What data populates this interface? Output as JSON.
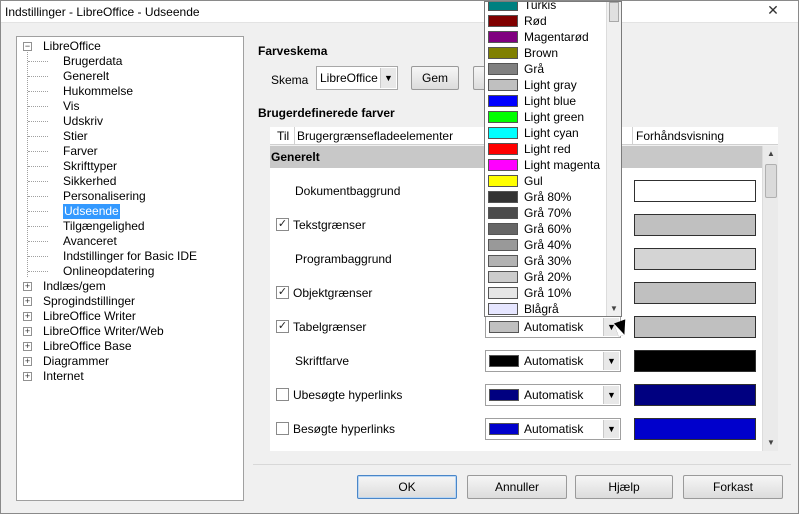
{
  "window": {
    "title": "Indstillinger - LibreOffice - Udseende"
  },
  "tree": {
    "root": "LibreOffice",
    "children": [
      "Brugerdata",
      "Generelt",
      "Hukommelse",
      "Vis",
      "Udskriv",
      "Stier",
      "Farver",
      "Skrifttyper",
      "Sikkerhed",
      "Personalisering",
      "Udseende",
      "Tilgængelighed",
      "Avanceret",
      "Indstillinger for Basic IDE",
      "Onlineopdatering"
    ],
    "selected": "Udseende",
    "others": [
      "Indlæs/gem",
      "Sprogindstillinger",
      "LibreOffice Writer",
      "LibreOffice Writer/Web",
      "LibreOffice Base",
      "Diagrammer",
      "Internet"
    ]
  },
  "scheme": {
    "section": "Farveskema",
    "label": "Skema",
    "value": "LibreOffice",
    "save": "Gem"
  },
  "custom": {
    "section": "Brugerdefinerede farver",
    "col_on": "Til",
    "col_elements": "Brugergrænsefladeelementer",
    "col_preview": "Forhåndsvisning",
    "group": "Generelt"
  },
  "rows": [
    {
      "label": "Dokumentbaggrund",
      "checkbox": false,
      "checked": false,
      "combo": "",
      "preview_color": "#ffffff"
    },
    {
      "label": "Tekstgrænser",
      "checkbox": true,
      "checked": true,
      "combo": "",
      "preview_color": "#c0c0c0"
    },
    {
      "label": "Programbaggrund",
      "checkbox": false,
      "checked": false,
      "combo": "",
      "preview_color": "#d4d4d4"
    },
    {
      "label": "Objektgrænser",
      "checkbox": true,
      "checked": true,
      "combo": "",
      "preview_color": "#c0c0c0"
    },
    {
      "label": "Tabelgrænser",
      "checkbox": true,
      "checked": true,
      "combo": "Automatisk",
      "swatch": "#c0c0c0",
      "preview_color": "#c0c0c0"
    },
    {
      "label": "Skriftfarve",
      "checkbox": false,
      "checked": false,
      "combo": "Automatisk",
      "swatch": "#000000",
      "preview_color": "#000000"
    },
    {
      "label": "Ubesøgte hyperlinks",
      "checkbox": true,
      "checked": false,
      "combo": "Automatisk",
      "swatch": "#000080",
      "preview_color": "#000080"
    },
    {
      "label": "Besøgte hyperlinks",
      "checkbox": true,
      "checked": false,
      "combo": "Automatisk",
      "swatch": "#0000cc",
      "preview_color": "#0000cc"
    }
  ],
  "dropdown": [
    {
      "name": "Turkis",
      "color": "#008080"
    },
    {
      "name": "Rød",
      "color": "#800000"
    },
    {
      "name": "Magentarød",
      "color": "#800080"
    },
    {
      "name": "Brown",
      "color": "#808000"
    },
    {
      "name": "Grå",
      "color": "#808080"
    },
    {
      "name": "Light gray",
      "color": "#c0c0c0"
    },
    {
      "name": "Light blue",
      "color": "#0000ff"
    },
    {
      "name": "Light green",
      "color": "#00ff00"
    },
    {
      "name": "Light cyan",
      "color": "#00ffff"
    },
    {
      "name": "Light red",
      "color": "#ff0000"
    },
    {
      "name": "Light magenta",
      "color": "#ff00ff"
    },
    {
      "name": "Gul",
      "color": "#ffff00"
    },
    {
      "name": "Grå 80%",
      "color": "#333333"
    },
    {
      "name": "Grå 70%",
      "color": "#4c4c4c"
    },
    {
      "name": "Grå 60%",
      "color": "#666666"
    },
    {
      "name": "Grå 40%",
      "color": "#999999"
    },
    {
      "name": "Grå 30%",
      "color": "#b2b2b2"
    },
    {
      "name": "Grå 20%",
      "color": "#cccccc"
    },
    {
      "name": "Grå 10%",
      "color": "#e6e6e6"
    },
    {
      "name": "Blågrå",
      "color": "#e6e6ff"
    }
  ],
  "buttons": {
    "ok": "OK",
    "cancel": "Annuller",
    "help": "Hjælp",
    "reset": "Forkast"
  }
}
